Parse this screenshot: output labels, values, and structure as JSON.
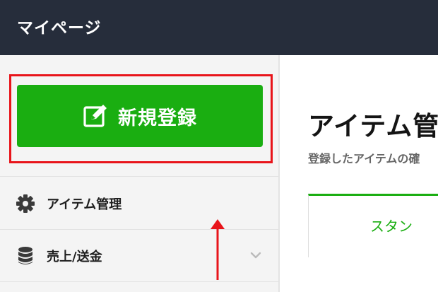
{
  "header": {
    "title": "マイページ"
  },
  "sidebar": {
    "new_button": {
      "label": "新規登録",
      "icon": "edit-icon"
    },
    "items": [
      {
        "label": "アイテム管理",
        "icon": "gear-icon"
      },
      {
        "label": "売上/送金",
        "icon": "database-icon",
        "chevron": "chevron-down-icon"
      }
    ]
  },
  "main": {
    "title": "アイテム管",
    "description": "登録したアイテムの確",
    "tab_label": "スタン"
  },
  "colors": {
    "header_bg": "#262d3b",
    "accent_green": "#1aae11",
    "highlight_red": "#e8141a"
  }
}
